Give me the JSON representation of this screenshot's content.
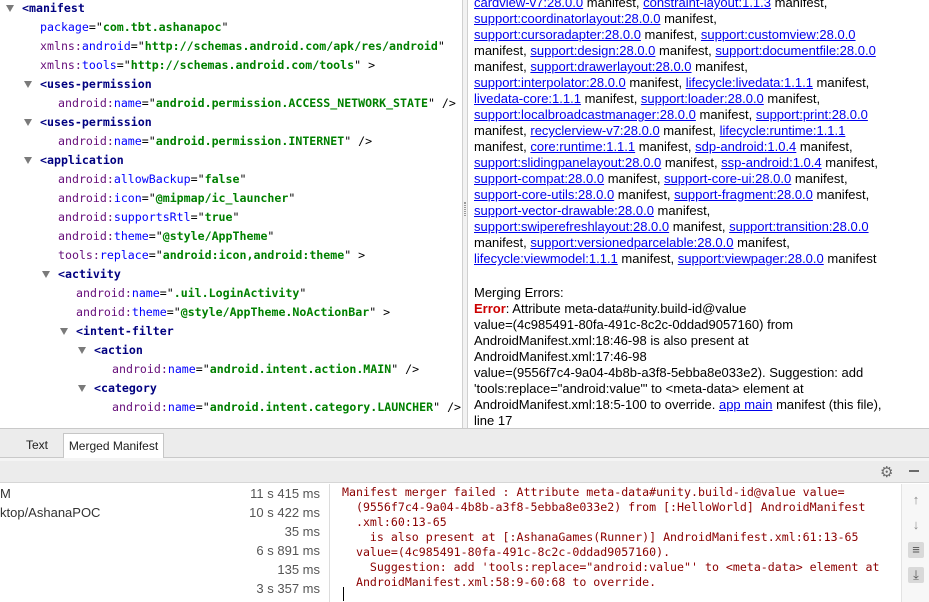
{
  "xml_tree": {
    "lines": [
      {
        "type": "tag",
        "label": "manifest"
      },
      {
        "type": "attr",
        "prefix": "",
        "name": "package",
        "value": "com.tbt.ashanapoc"
      },
      {
        "type": "attr",
        "prefix": "xmlns:",
        "name": "android",
        "value": "http://schemas.android.com/apk/res/android"
      },
      {
        "type": "attr",
        "prefix": "xmlns:",
        "name": "tools",
        "value": "http://schemas.android.com/tools",
        "end": " >"
      },
      {
        "type": "tag",
        "label": "uses-permission"
      },
      {
        "type": "attr",
        "prefix": "android:",
        "name": "name",
        "value": "android.permission.ACCESS_NETWORK_STATE",
        "end": " />"
      },
      {
        "type": "tag",
        "label": "uses-permission"
      },
      {
        "type": "attr",
        "prefix": "android:",
        "name": "name",
        "value": "android.permission.INTERNET",
        "end": " />"
      },
      {
        "type": "tag",
        "label": "application"
      },
      {
        "type": "attr",
        "prefix": "android:",
        "name": "allowBackup",
        "value": "false"
      },
      {
        "type": "attr",
        "prefix": "android:",
        "name": "icon",
        "value": "@mipmap/ic_launcher"
      },
      {
        "type": "attr",
        "prefix": "android:",
        "name": "supportsRtl",
        "value": "true"
      },
      {
        "type": "attr",
        "prefix": "android:",
        "name": "theme",
        "value": "@style/AppTheme"
      },
      {
        "type": "attr",
        "prefix": "tools:",
        "name": "replace",
        "value": "android:icon,android:theme",
        "end": " >"
      },
      {
        "type": "tag",
        "label": "activity"
      },
      {
        "type": "attr",
        "prefix": "android:",
        "name": "name",
        "value": ".uil.LoginActivity"
      },
      {
        "type": "attr",
        "prefix": "android:",
        "name": "theme",
        "value": "@style/AppTheme.NoActionBar",
        "end": " >"
      },
      {
        "type": "tag",
        "label": "intent-filter"
      },
      {
        "type": "tag",
        "label": "action"
      },
      {
        "type": "attr",
        "prefix": "android:",
        "name": "name",
        "value": "android.intent.action.MAIN",
        "end": " />"
      },
      {
        "type": "tag",
        "label": "category"
      },
      {
        "type": "attr",
        "prefix": "android:",
        "name": "name",
        "value": "android.intent.category.LAUNCHER",
        "end": " />"
      }
    ]
  },
  "info_pane": {
    "lines": [
      [
        {
          "t": "cardview-v7:28.0.0",
          "l": true
        },
        {
          "t": " manifest, "
        },
        {
          "t": "constraint-layout:1.1.3",
          "l": true
        },
        {
          "t": " manifest,"
        }
      ],
      [
        {
          "t": "support:coordinatorlayout:28.0.0",
          "l": true
        },
        {
          "t": " manifest,"
        }
      ],
      [
        {
          "t": "support:cursoradapter:28.0.0",
          "l": true
        },
        {
          "t": " manifest, "
        },
        {
          "t": "support:customview:28.0.0",
          "l": true
        }
      ],
      [
        {
          "t": "manifest, "
        },
        {
          "t": "support:design:28.0.0",
          "l": true
        },
        {
          "t": " manifest, "
        },
        {
          "t": "support:documentfile:28.0.0",
          "l": true
        }
      ],
      [
        {
          "t": "manifest, "
        },
        {
          "t": "support:drawerlayout:28.0.0",
          "l": true
        },
        {
          "t": " manifest,"
        }
      ],
      [
        {
          "t": "support:interpolator:28.0.0",
          "l": true
        },
        {
          "t": " manifest, "
        },
        {
          "t": "lifecycle:livedata:1.1.1",
          "l": true
        },
        {
          "t": " manifest,"
        }
      ],
      [
        {
          "t": "livedata-core:1.1.1",
          "l": true
        },
        {
          "t": " manifest, "
        },
        {
          "t": "support:loader:28.0.0",
          "l": true
        },
        {
          "t": " manifest,"
        }
      ],
      [
        {
          "t": "support:localbroadcastmanager:28.0.0",
          "l": true
        },
        {
          "t": " manifest, "
        },
        {
          "t": "support:print:28.0.0",
          "l": true
        }
      ],
      [
        {
          "t": "manifest, "
        },
        {
          "t": "recyclerview-v7:28.0.0",
          "l": true
        },
        {
          "t": " manifest, "
        },
        {
          "t": "lifecycle:runtime:1.1.1",
          "l": true
        }
      ],
      [
        {
          "t": "manifest, "
        },
        {
          "t": "core:runtime:1.1.1",
          "l": true
        },
        {
          "t": " manifest, "
        },
        {
          "t": "sdp-android:1.0.4",
          "l": true
        },
        {
          "t": " manifest,"
        }
      ],
      [
        {
          "t": "support:slidingpanelayout:28.0.0",
          "l": true
        },
        {
          "t": " manifest, "
        },
        {
          "t": "ssp-android:1.0.4",
          "l": true
        },
        {
          "t": " manifest,"
        }
      ],
      [
        {
          "t": "support-compat:28.0.0",
          "l": true
        },
        {
          "t": " manifest, "
        },
        {
          "t": "support-core-ui:28.0.0",
          "l": true
        },
        {
          "t": " manifest,"
        }
      ],
      [
        {
          "t": "support-core-utils:28.0.0",
          "l": true
        },
        {
          "t": " manifest, "
        },
        {
          "t": "support-fragment:28.0.0",
          "l": true
        },
        {
          "t": " manifest,"
        }
      ],
      [
        {
          "t": "support-vector-drawable:28.0.0",
          "l": true
        },
        {
          "t": " manifest,"
        }
      ],
      [
        {
          "t": "support:swiperefreshlayout:28.0.0",
          "l": true
        },
        {
          "t": " manifest, "
        },
        {
          "t": "support:transition:28.0.0",
          "l": true
        }
      ],
      [
        {
          "t": "manifest, "
        },
        {
          "t": "support:versionedparcelable:28.0.0",
          "l": true
        },
        {
          "t": " manifest,"
        }
      ],
      [
        {
          "t": "lifecycle:viewmodel:1.1.1",
          "l": true
        },
        {
          "t": " manifest, "
        },
        {
          "t": "support:viewpager:28.0.0",
          "l": true
        },
        {
          "t": " manifest"
        }
      ],
      [],
      [
        {
          "t": "Merging Errors:"
        }
      ],
      [
        {
          "t": "Error",
          "e": true
        },
        {
          "t": ": Attribute meta-data#unity.build-id@value"
        }
      ],
      [
        {
          "t": "value=(4c985491-80fa-491c-8c2c-0ddad9057160) from"
        }
      ],
      [
        {
          "t": "AndroidManifest.xml:18:46-98 is also present at"
        }
      ],
      [
        {
          "t": "AndroidManifest.xml:17:46-98"
        }
      ],
      [
        {
          "t": "value=(9556f7c4-9a04-4b8b-a3f8-5ebba8e033e2). Suggestion: add"
        }
      ],
      [
        {
          "t": "'tools:replace=\"android:value\"' to <meta-data> element at"
        }
      ],
      [
        {
          "t": "AndroidManifest.xml:18:5-100 to override. "
        },
        {
          "t": "app main",
          "l": true
        },
        {
          "t": " manifest (this file),"
        }
      ],
      [
        {
          "t": "line 17"
        }
      ]
    ]
  },
  "tabs": {
    "text": "Text",
    "merged": "Merged Manifest"
  },
  "build_tree": {
    "rows": [
      {
        "name": "M",
        "time": "11 s 415 ms"
      },
      {
        "name": "ktop/AshanaPOC",
        "time": "10 s 422 ms"
      },
      {
        "name": "",
        "time": "35 ms"
      },
      {
        "name": "",
        "time": "6 s 891 ms"
      },
      {
        "name": "",
        "time": "135 ms"
      },
      {
        "name": "",
        "time": "3 s 357 ms"
      }
    ]
  },
  "console": {
    "lines": [
      "Manifest merger failed : Attribute meta-data#unity.build-id@value value=",
      "  (9556f7c4-9a04-4b8b-a3f8-5ebba8e033e2) from [:HelloWorld] AndroidManifest",
      "  .xml:60:13-65",
      "    is also present at [:AshanaGames(Runner)] AndroidManifest.xml:61:13-65",
      "  value=(4c985491-80fa-491c-8c2c-0ddad9057160).",
      "    Suggestion: add 'tools:replace=\"android:value\"' to <meta-data> element at",
      "  AndroidManifest.xml:58:9-60:68 to override."
    ]
  },
  "side_tools": [
    "up-arrow-icon",
    "down-arrow-icon",
    "soft-wrap-icon",
    "scroll-to-end-icon"
  ]
}
